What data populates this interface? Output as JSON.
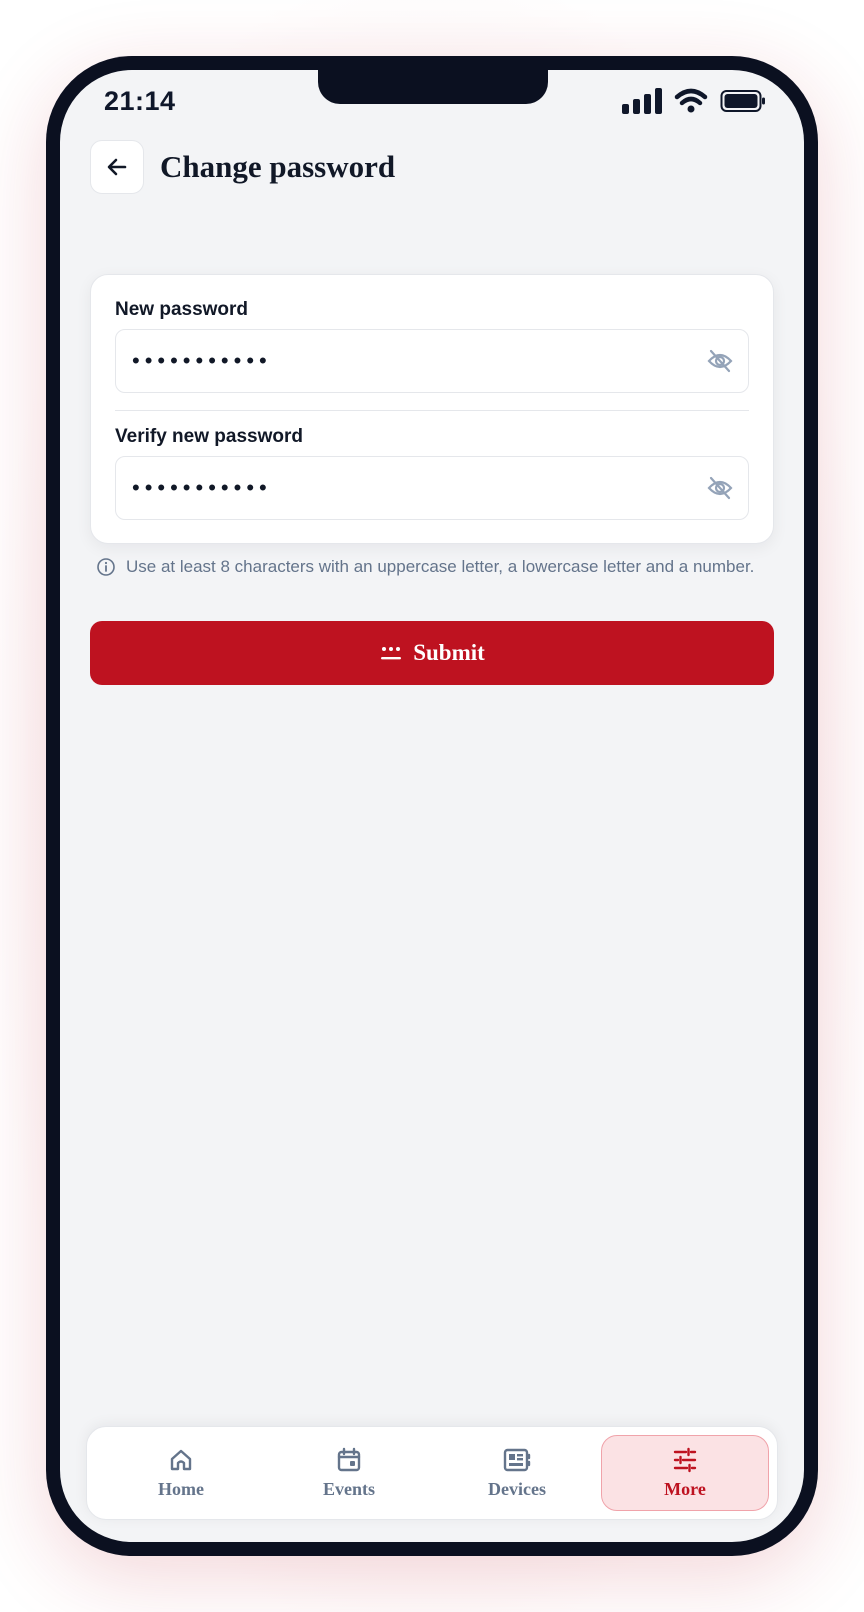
{
  "status_bar": {
    "time": "21:14"
  },
  "header": {
    "title": "Change password"
  },
  "form": {
    "new_password": {
      "label": "New password",
      "value": "•••••••••••"
    },
    "verify_password": {
      "label": "Verify new password",
      "value": "•••••••••••"
    },
    "hint": "Use at least 8 characters with an uppercase letter, a lowercase letter and a number.",
    "submit_label": "Submit"
  },
  "nav": {
    "items": [
      {
        "label": "Home",
        "icon": "home-icon"
      },
      {
        "label": "Events",
        "icon": "calendar-icon"
      },
      {
        "label": "Devices",
        "icon": "devices-icon"
      },
      {
        "label": "More",
        "icon": "sliders-icon",
        "active": true
      }
    ]
  },
  "colors": {
    "accent": "#be1220",
    "accent_soft": "#fbe2e4",
    "text": "#111827",
    "muted": "#64748b"
  }
}
